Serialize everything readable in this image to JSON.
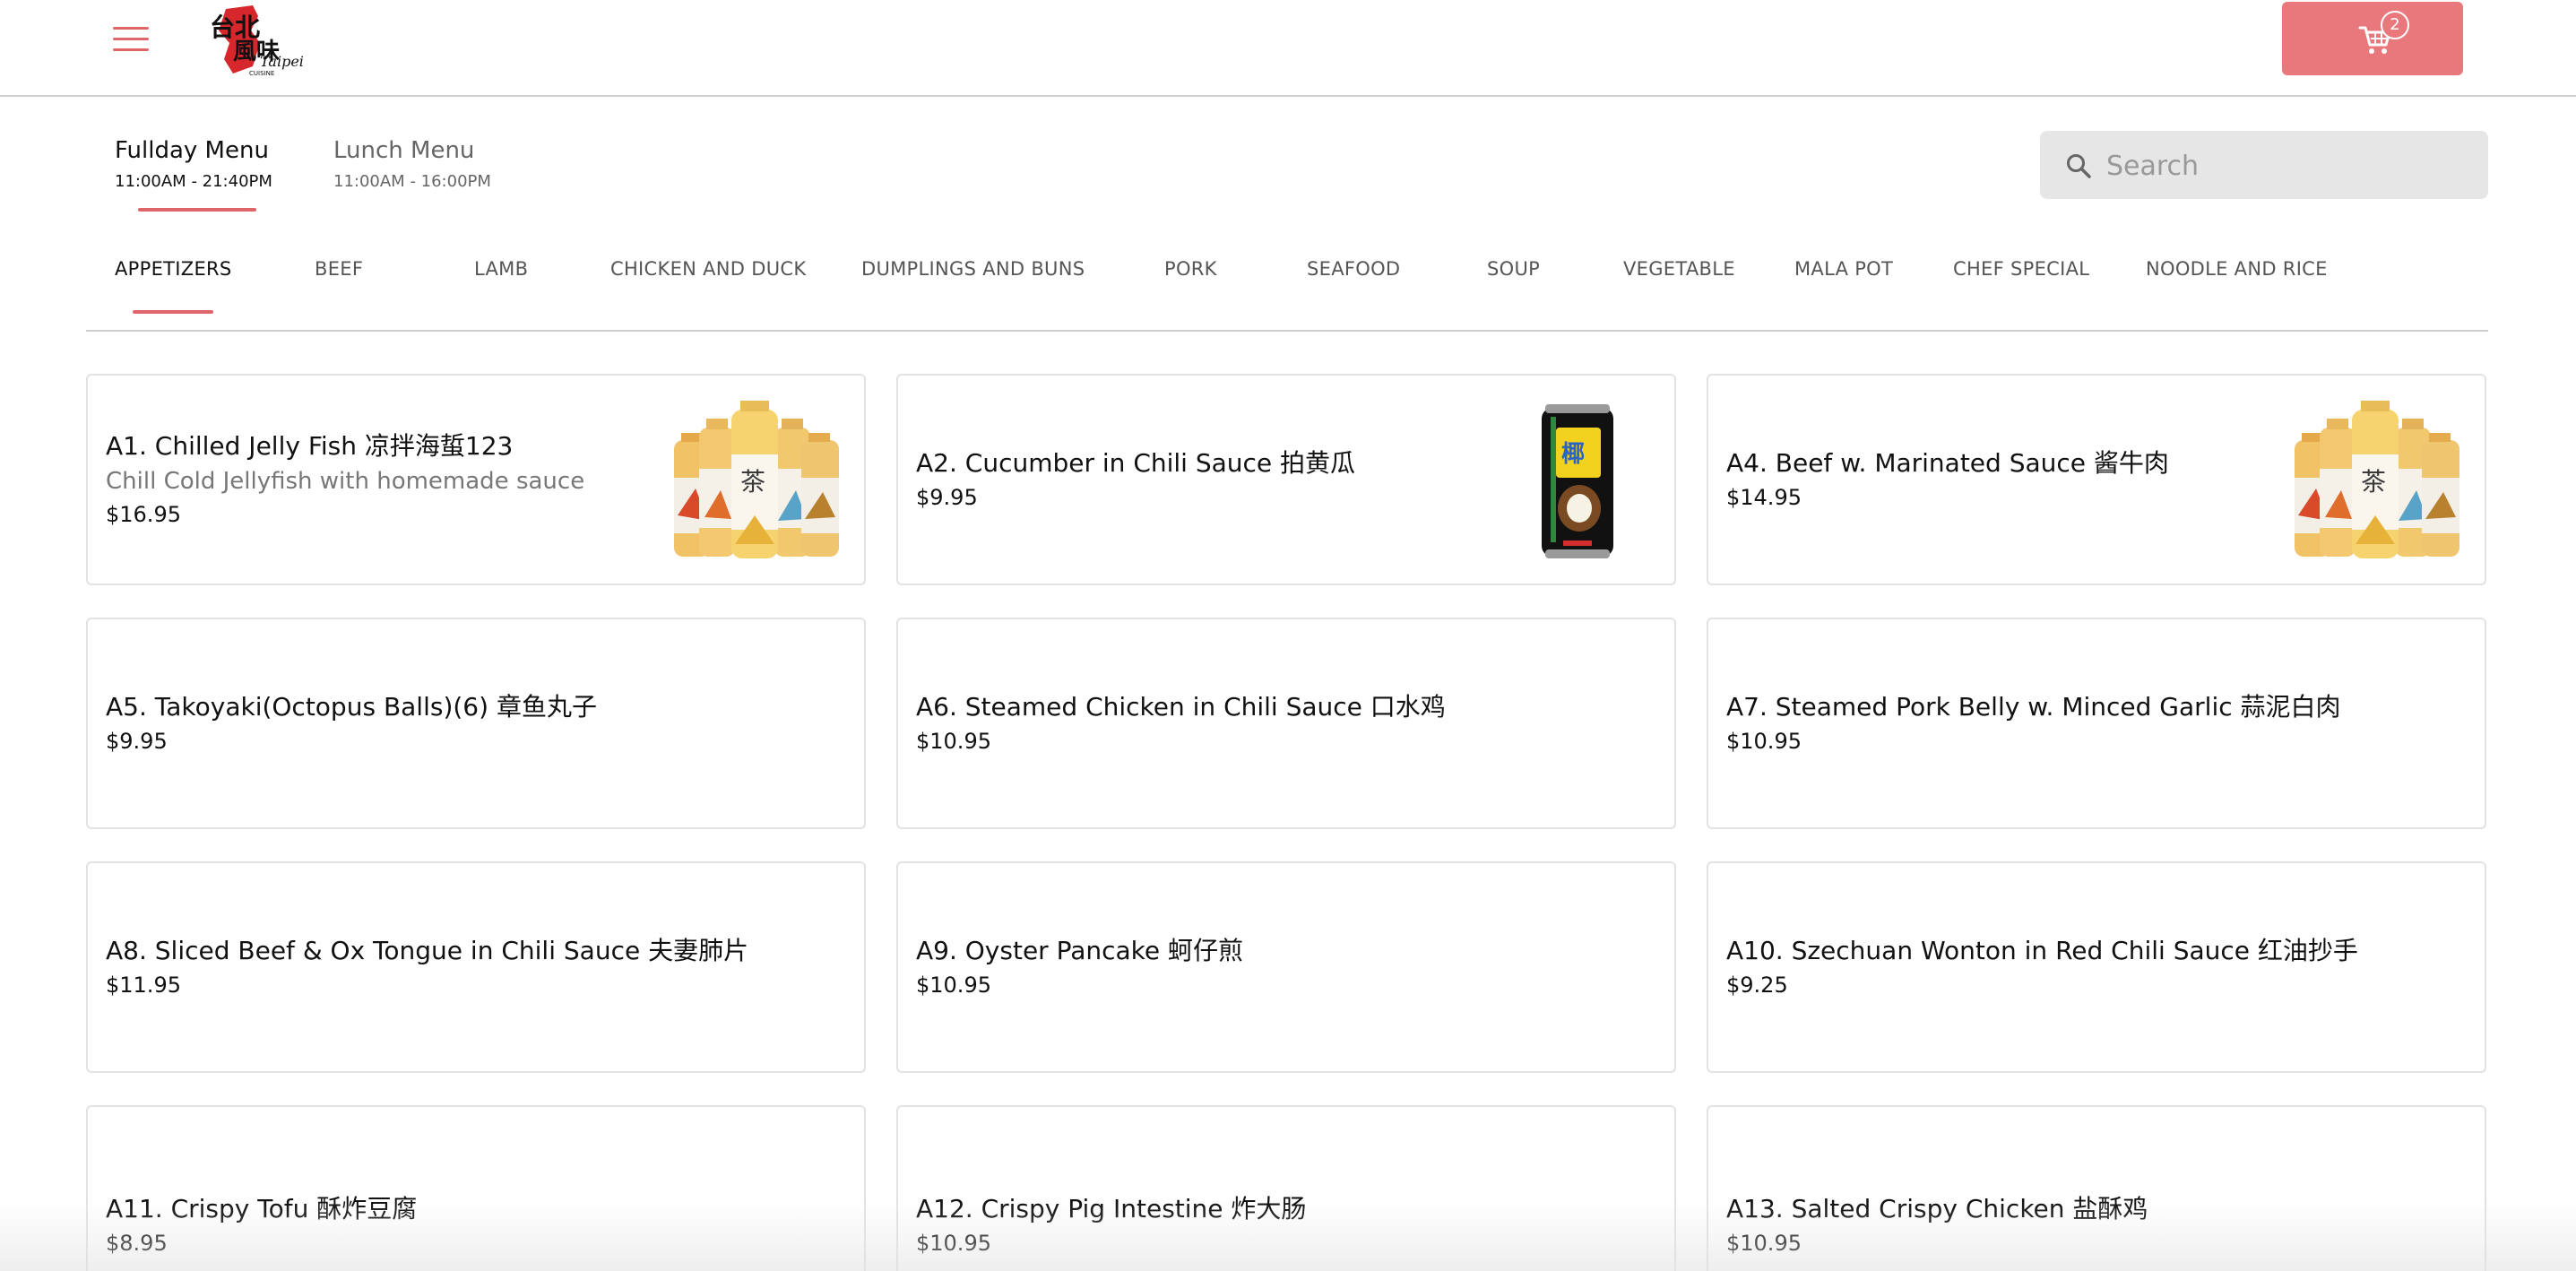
{
  "header": {
    "cart_count": "2",
    "logo_text_cn": "台北風味",
    "logo_text_en": "Taipei",
    "logo_text_sub": "CUISINE"
  },
  "menus": {
    "fullday": {
      "title": "Fullday Menu",
      "hours": "11:00AM - 21:40PM"
    },
    "lunch": {
      "title": "Lunch Menu",
      "hours": "11:00AM - 16:00PM"
    }
  },
  "search": {
    "placeholder": "Search",
    "value": ""
  },
  "categories": [
    "APPETIZERS",
    "BEEF",
    "LAMB",
    "CHICKEN AND DUCK",
    "DUMPLINGS AND BUNS",
    "PORK",
    "SEAFOOD",
    "SOUP",
    "VEGETABLE",
    "MALA POT",
    "CHEF SPECIAL",
    "NOODLE AND RICE"
  ],
  "items": [
    {
      "title": "A1. Chilled Jelly Fish 凉拌海蜇123",
      "desc": "Chill Cold Jellyfish with homemade sauce",
      "price": "$16.95",
      "image": "tea-bottles"
    },
    {
      "title": "A2. Cucumber in Chili Sauce 拍黄瓜",
      "desc": "",
      "price": "$9.95",
      "image": "coconut-can"
    },
    {
      "title": "A4. Beef w. Marinated Sauce 酱牛肉",
      "desc": "",
      "price": "$14.95",
      "image": "tea-bottles"
    },
    {
      "title": "A5. Takoyaki(Octopus Balls)(6) 章鱼丸子",
      "desc": "",
      "price": "$9.95",
      "image": ""
    },
    {
      "title": "A6. Steamed Chicken in Chili Sauce 口水鸡",
      "desc": "",
      "price": "$10.95",
      "image": ""
    },
    {
      "title": "A7. Steamed Pork Belly w. Minced Garlic 蒜泥白肉",
      "desc": "",
      "price": "$10.95",
      "image": ""
    },
    {
      "title": "A8. Sliced Beef & Ox Tongue in Chili Sauce 夫妻肺片",
      "desc": "",
      "price": "$11.95",
      "image": ""
    },
    {
      "title": "A9. Oyster Pancake 蚵仔煎",
      "desc": "",
      "price": "$10.95",
      "image": ""
    },
    {
      "title": "A10. Szechuan Wonton in Red Chili Sauce 红油抄手",
      "desc": "",
      "price": "$9.25",
      "image": ""
    },
    {
      "title": "A11. Crispy Tofu 酥炸豆腐",
      "desc": "",
      "price": "$8.95",
      "image": ""
    },
    {
      "title": "A12. Crispy Pig Intestine 炸大肠",
      "desc": "",
      "price": "$10.95",
      "image": ""
    },
    {
      "title": "A13. Salted Crispy Chicken 盐酥鸡",
      "desc": "",
      "price": "$10.95",
      "image": ""
    }
  ],
  "colors": {
    "accent": "#e0656a",
    "cart_button": "#e8787b",
    "search_bg": "#e6e6e6",
    "divider": "#cfcfcf"
  },
  "icons": {
    "menu": "hamburger-icon",
    "cart": "shopping-cart-icon",
    "search": "magnifier-icon"
  }
}
